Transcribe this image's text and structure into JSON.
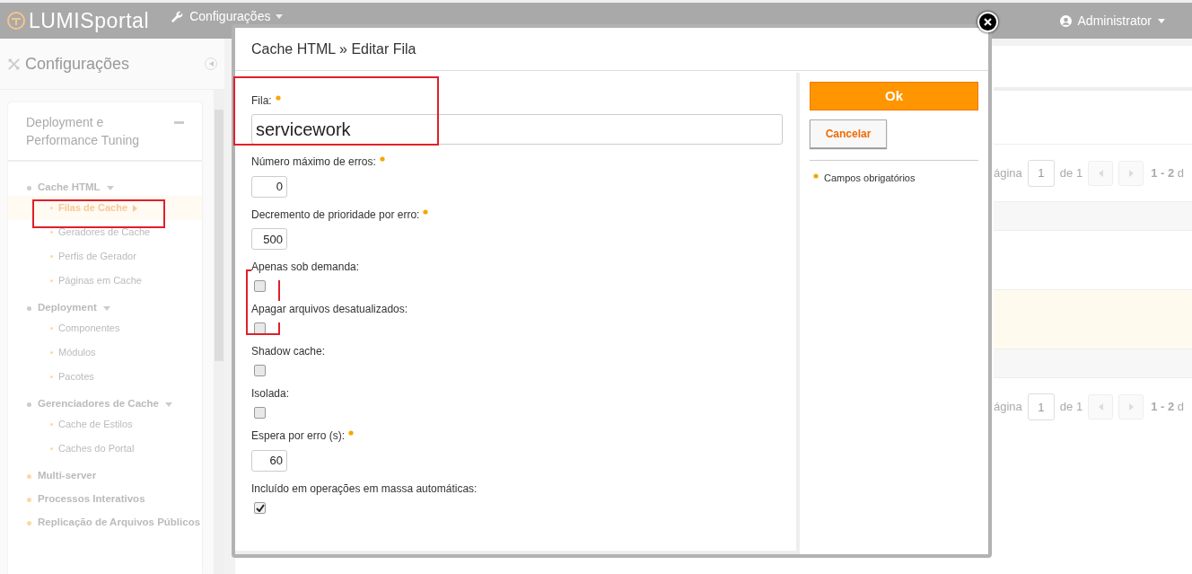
{
  "topbar": {
    "logo": "LUMISportal",
    "menu": "Configurações",
    "user": "Administrator"
  },
  "sidebar": {
    "title": "Configurações",
    "section": "Deployment e Performance Tuning",
    "items": [
      {
        "label": "Cache HTML",
        "kind": "group",
        "selected": false,
        "children": [
          {
            "label": "Filas de Cache",
            "selected": true
          },
          {
            "label": "Geradores de Cache",
            "selected": false
          },
          {
            "label": "Perfis de Gerador",
            "selected": false
          },
          {
            "label": "Páginas em Cache",
            "selected": false
          }
        ]
      },
      {
        "label": "Deployment",
        "kind": "group",
        "selected": false,
        "children": [
          {
            "label": "Componentes",
            "selected": false
          },
          {
            "label": "Módulos",
            "selected": false
          },
          {
            "label": "Pacotes",
            "selected": false
          }
        ]
      },
      {
        "label": "Gerenciadores de Cache",
        "kind": "group",
        "selected": false,
        "children": [
          {
            "label": "Cache de Estilos",
            "selected": false
          },
          {
            "label": "Caches do Portal",
            "selected": false
          }
        ]
      },
      {
        "label": "Multi-server",
        "kind": "link",
        "selected": false
      },
      {
        "label": "Processos Interativos",
        "kind": "link",
        "selected": false
      },
      {
        "label": "Replicação de Arquivos Públicos",
        "kind": "link",
        "selected": false
      }
    ]
  },
  "background": {
    "paginations": [
      {
        "label": "ágina",
        "page": "1",
        "of": "de 1",
        "range": "**1 - 2** d"
      },
      {
        "label": "ágina",
        "page": "1",
        "of": "de 1",
        "range": "**1 - 2** d"
      }
    ]
  },
  "dialog": {
    "title": "Cache HTML » Editar Fila",
    "fields": [
      {
        "kind": "large",
        "label": "Fila:",
        "required": true,
        "value": "servicework"
      },
      {
        "kind": "number",
        "label": "Número máximo de erros:",
        "required": true,
        "value": "0"
      },
      {
        "kind": "number",
        "label": "Decremento de prioridade por erro:",
        "required": true,
        "value": "500"
      },
      {
        "kind": "checkbox",
        "label": "Apenas sob demanda:",
        "required": false,
        "checked": false
      },
      {
        "kind": "checkbox",
        "label": "Apagar arquivos desatualizados:",
        "required": false,
        "checked": false
      },
      {
        "kind": "checkbox",
        "label": "Shadow cache:",
        "required": false,
        "checked": false
      },
      {
        "kind": "checkbox",
        "label": "Isolada:",
        "required": false,
        "checked": false
      },
      {
        "kind": "number",
        "label": "Espera por erro (s):",
        "required": true,
        "value": "60"
      },
      {
        "kind": "checkbox",
        "label": "Incluído em operações em massa automáticas:",
        "required": false,
        "checked": true
      }
    ],
    "ok": "Ok",
    "cancel": "Cancelar",
    "legend": "Campos obrigatórios"
  }
}
